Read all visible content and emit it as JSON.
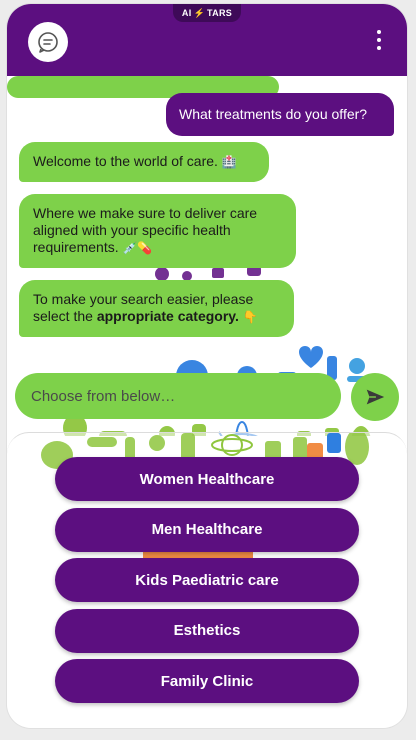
{
  "header": {
    "brand_prefix": "AI",
    "brand_suffix": "TARS",
    "avatar_icon": "chat-bubble-icon",
    "menu_icon": "more-vertical-icon"
  },
  "messages": [
    {
      "from": "user",
      "text": "What treatments do you offer?"
    },
    {
      "from": "bot",
      "text": "Welcome to the world of care.",
      "emoji": "🏥"
    },
    {
      "from": "bot",
      "text": "Where we make sure to deliver care aligned with your specific health requirements.",
      "emoji": "💉💊"
    },
    {
      "from": "bot",
      "text_before": "To make your search easier, please select the ",
      "text_bold": "appropriate category.",
      "emoji": "👇"
    }
  ],
  "input": {
    "placeholder": "Choose from below…",
    "send_icon": "send-icon"
  },
  "options": [
    {
      "label": "Women Healthcare"
    },
    {
      "label": "Men Healthcare"
    },
    {
      "label": "Kids Paediatric care"
    },
    {
      "label": "Esthetics"
    },
    {
      "label": "Family Clinic"
    }
  ],
  "colors": {
    "primary": "#5c0f80",
    "accent_green": "#7ed14a",
    "decor_blue": "#2f7fe0",
    "decor_orange": "#f0a040"
  }
}
